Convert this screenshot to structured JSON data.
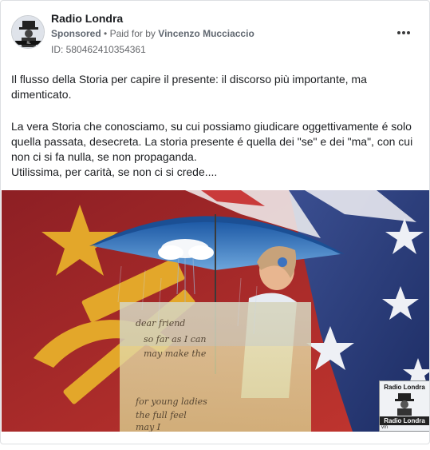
{
  "post": {
    "page_name": "Radio Londra",
    "sponsored_label": "Sponsored",
    "separator": "•",
    "paid_for_prefix": "Paid for by",
    "payer": "Vincenzo Mucciaccio",
    "library_id": "ID: 580462410354361",
    "more_icon": "more-horizontal-icon"
  },
  "body": {
    "paragraph_1": "Il flusso della Storia per capire il presente: il discorso più importante, ma dimenticato.",
    "paragraph_2_line_1": "La vera Storia che conosciamo, su cui possiamo giudicare oggettivamente é solo quella passata, desecreta. La storia presente é quella dei \"se\" e dei \"ma\", con cui non ci si fa nulla, se non propaganda.",
    "paragraph_2_line_2": "Utilissima, per carità, se non ci si crede...."
  },
  "media": {
    "handwriting_lines": [
      "dear friend",
      "so far as I can",
      "may make the",
      "for young ladies",
      "the full feel",
      "may I"
    ],
    "watermark_title": "Radio Londra",
    "watermark_name": "Radio Londra",
    "watermark_foot": "vm"
  },
  "colors": {
    "red_flag": "#b3262a",
    "blue_flag": "#253a79",
    "gold": "#e3a72a",
    "sky": "#2f6fb5"
  }
}
